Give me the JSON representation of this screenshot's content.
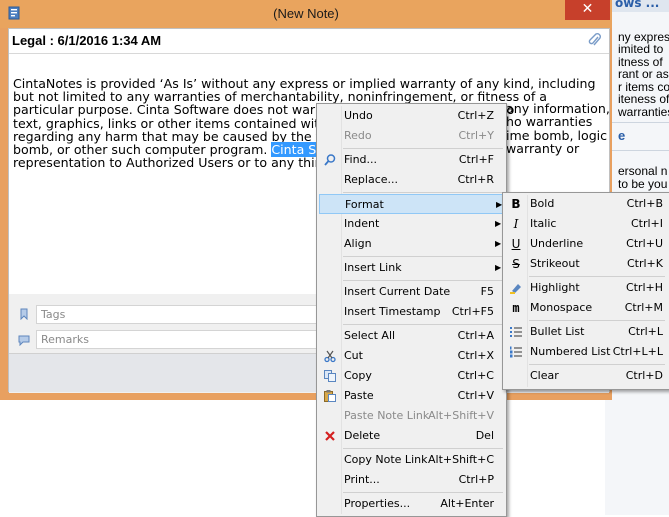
{
  "window": {
    "title": "(New Note)",
    "close_glyph": "✕"
  },
  "note": {
    "title": "Legal : 6/1/2016 1:34 AM",
    "text_before": "CintaNotes is provided ‘As Is’ without any express or implied warranty of any kind, including but not limited to any warranties of merchantability, noninfringement, or fitness of a particular purpose. Cinta Software does not warrant or assume responsibility fo",
    "text_l3": "text, graphics, links or other items contained within the",
    "text_l4": "regarding any harm that may be caused by the transm",
    "text_l5a": "bomb, or other such computer program. ",
    "selected": "Cinta Software",
    "text_l6": "representation to Authorized Users or to any third part",
    "right_l2": "any information,",
    "right_l3": "ho warranties",
    "right_l4": "ime bomb, logic",
    "right_l5": "warranty or"
  },
  "fields": {
    "tags_placeholder": "Tags",
    "remarks_placeholder": "Remarks"
  },
  "background_window": {
    "title": "ows ...",
    "lines_top": [
      "ny expres",
      "imited to",
      "itness of",
      "rant or ass",
      "r items co",
      "iteness of",
      "warranties"
    ],
    "section_heading": "e",
    "lines_bottom": [
      "ersonal n",
      "to be you"
    ]
  },
  "context_menu": {
    "items": [
      {
        "label": "Undo",
        "shortcut": "Ctrl+Z"
      },
      {
        "label": "Redo",
        "shortcut": "Ctrl+Y"
      },
      {
        "label": "Find...",
        "shortcut": "Ctrl+F"
      },
      {
        "label": "Replace...",
        "shortcut": "Ctrl+R"
      },
      {
        "label": "Format",
        "shortcut": ""
      },
      {
        "label": "Indent",
        "shortcut": ""
      },
      {
        "label": "Align",
        "shortcut": ""
      },
      {
        "label": "Insert Link",
        "shortcut": ""
      },
      {
        "label": "Insert Current Date",
        "shortcut": "F5"
      },
      {
        "label": "Insert Timestamp",
        "shortcut": "Ctrl+F5"
      },
      {
        "label": "Select All",
        "shortcut": "Ctrl+A"
      },
      {
        "label": "Cut",
        "shortcut": "Ctrl+X"
      },
      {
        "label": "Copy",
        "shortcut": "Ctrl+C"
      },
      {
        "label": "Paste",
        "shortcut": "Ctrl+V"
      },
      {
        "label": "Paste Note Link",
        "shortcut": "Alt+Shift+V"
      },
      {
        "label": "Delete",
        "shortcut": "Del"
      },
      {
        "label": "Copy Note Link",
        "shortcut": "Alt+Shift+C"
      },
      {
        "label": "Print...",
        "shortcut": "Ctrl+P"
      },
      {
        "label": "Properties...",
        "shortcut": "Alt+Enter"
      }
    ]
  },
  "format_menu": {
    "items": [
      {
        "label": "Bold",
        "shortcut": "Ctrl+B",
        "glyph": "B"
      },
      {
        "label": "Italic",
        "shortcut": "Ctrl+I",
        "glyph": "I"
      },
      {
        "label": "Underline",
        "shortcut": "Ctrl+U",
        "glyph": "U"
      },
      {
        "label": "Strikeout",
        "shortcut": "Ctrl+K",
        "glyph": "S"
      },
      {
        "label": "Highlight",
        "shortcut": "Ctrl+H",
        "glyph": ""
      },
      {
        "label": "Monospace",
        "shortcut": "Ctrl+M",
        "glyph": "m"
      },
      {
        "label": "Bullet List",
        "shortcut": "Ctrl+L",
        "glyph": ""
      },
      {
        "label": "Numbered List",
        "shortcut": "Ctrl+L+L",
        "glyph": ""
      },
      {
        "label": "Clear",
        "shortcut": "Ctrl+D",
        "glyph": ""
      }
    ]
  },
  "colors": {
    "window_frame": "#e9a45e",
    "close": "#c7402b",
    "selection": "#3399ff",
    "menu_highlight": "#cde4f7"
  }
}
